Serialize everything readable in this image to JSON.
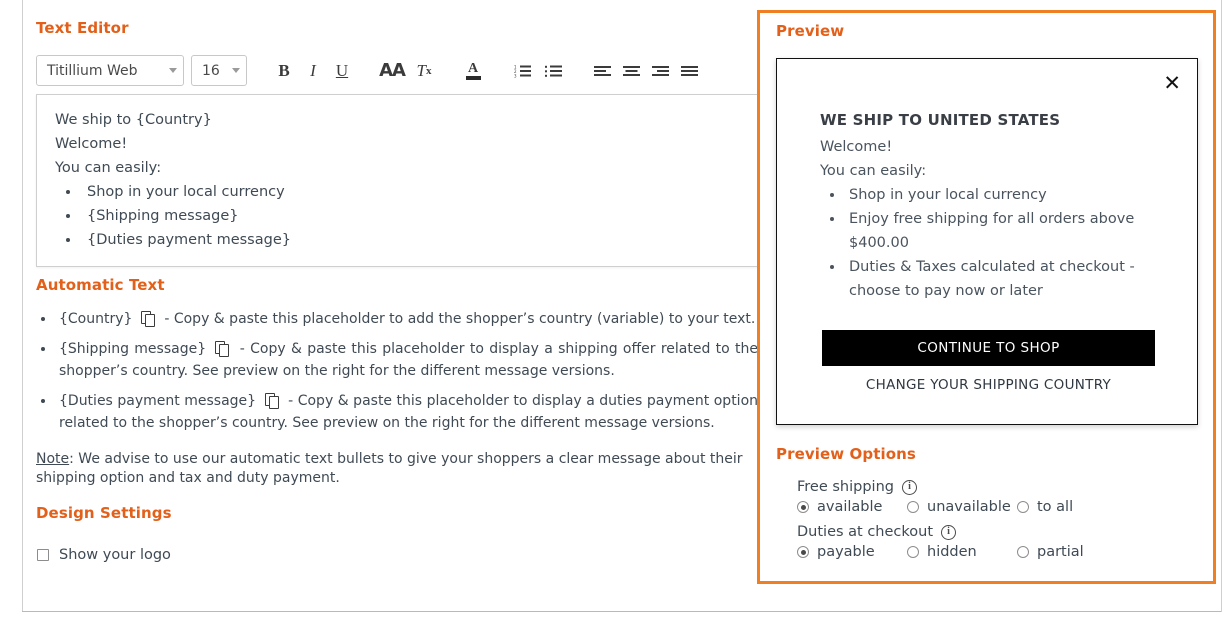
{
  "editor": {
    "heading": "Text Editor",
    "font_family": "Titillium Web",
    "font_size": "16",
    "toolbar": {
      "bold": "B",
      "italic": "I",
      "underline": "U",
      "font_size_icon": "AA",
      "clear_format_icon": "T",
      "clear_format_sub": "x",
      "font_color_icon": "A"
    },
    "content": {
      "line1": "We ship to {Country}",
      "line2": "Welcome!",
      "line3": "You can easily:",
      "bullets": [
        "Shop in your local currency",
        "{Shipping message}",
        "{Duties payment message}"
      ]
    }
  },
  "automatic_text": {
    "heading": "Automatic Text",
    "items": [
      {
        "placeholder": "{Country}",
        "description": "- Copy & paste this placeholder to add the shopper’s country (variable) to your text."
      },
      {
        "placeholder": "{Shipping message}",
        "description": "- Copy & paste this placeholder to display a shipping offer related to the shopper’s country. See preview on the right for the different message versions."
      },
      {
        "placeholder": "{Duties payment message}",
        "description": "- Copy & paste this placeholder to display a duties payment option related to the shopper’s country. See preview on the right for the different message versions."
      }
    ],
    "note_label": "Note",
    "note_text": ": We advise to use our automatic text bullets to give your shoppers a clear message about their shipping option and tax and duty payment."
  },
  "design_settings": {
    "heading": "Design Settings",
    "show_logo_label": "Show your logo",
    "show_logo_checked": false
  },
  "preview": {
    "heading": "Preview",
    "close_icon": "✕",
    "modal": {
      "title": "WE SHIP TO UNITED STATES",
      "line1": "Welcome!",
      "line2": "You can easily:",
      "bullets": [
        "Shop in your local currency",
        "Enjoy free shipping for all orders above $400.00",
        "Duties & Taxes calculated at checkout - choose to pay now or later"
      ],
      "cta_label": "CONTINUE TO SHOP",
      "link_label": "CHANGE YOUR SHIPPING COUNTRY"
    }
  },
  "preview_options": {
    "heading": "Preview Options",
    "groups": [
      {
        "label": "Free shipping",
        "info_icon": "i",
        "options": [
          {
            "label": "available",
            "selected": true
          },
          {
            "label": "unavailable",
            "selected": false
          },
          {
            "label": "to all",
            "selected": false
          }
        ]
      },
      {
        "label": "Duties at checkout",
        "info_icon": "i",
        "options": [
          {
            "label": "payable",
            "selected": true
          },
          {
            "label": "hidden",
            "selected": false
          },
          {
            "label": "partial",
            "selected": false
          }
        ]
      }
    ]
  },
  "colors": {
    "accent_orange": "#e2601a",
    "panel_border_orange": "#ef7f22",
    "text": "#3f4a54",
    "cta_bg": "#000000"
  }
}
